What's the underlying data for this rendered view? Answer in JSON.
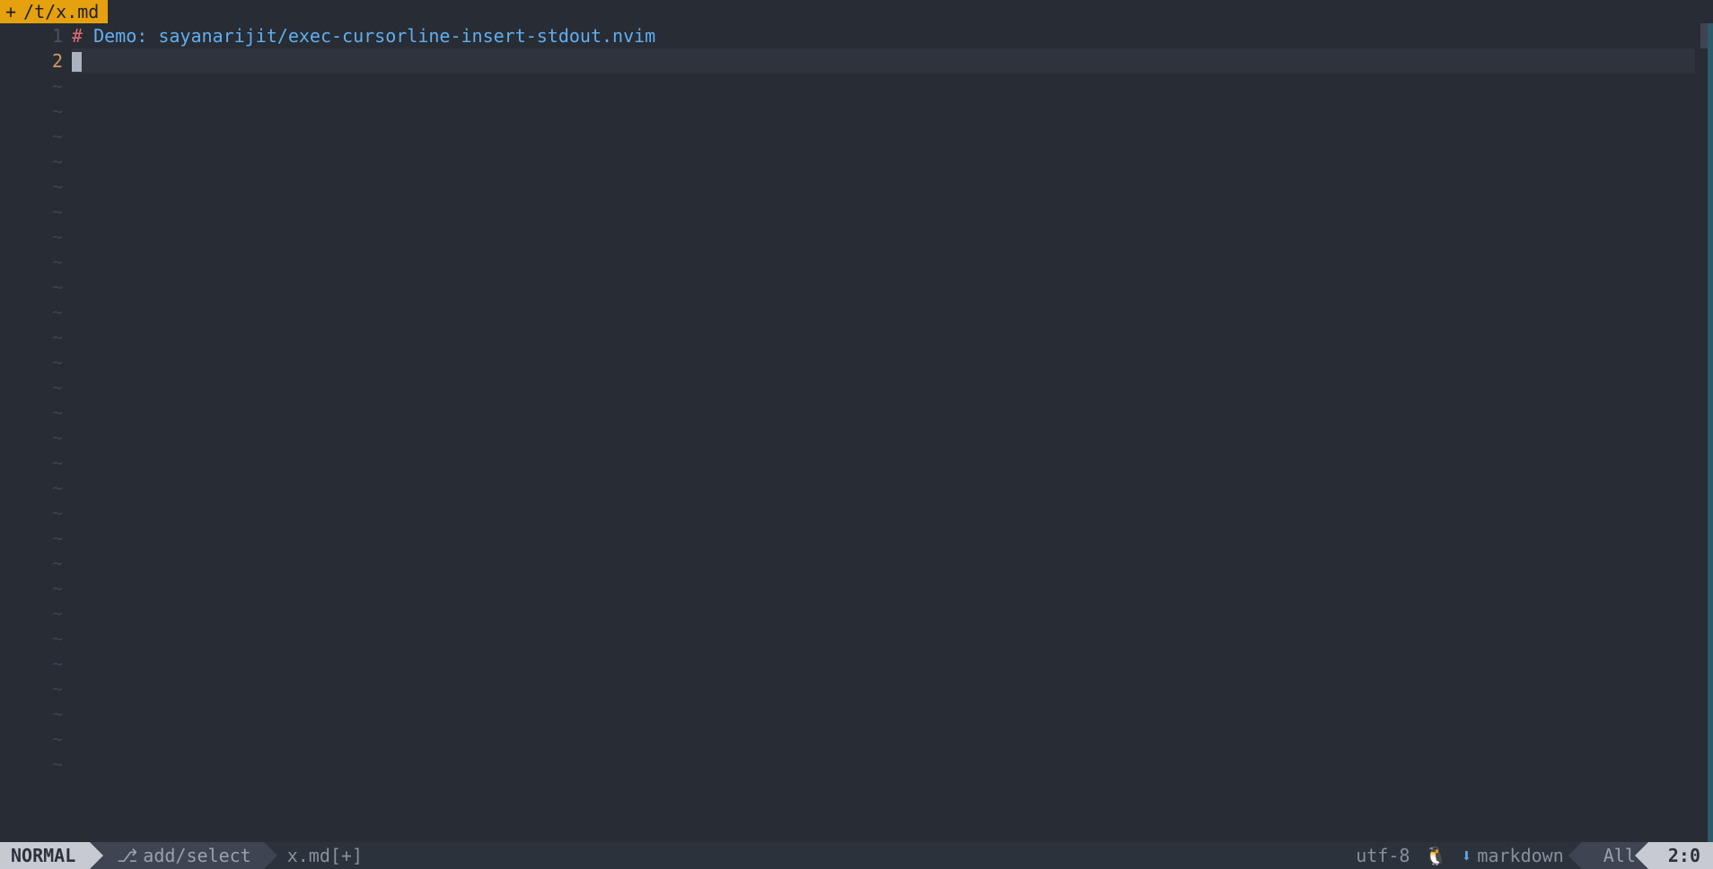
{
  "tab": {
    "modified_indicator": "+",
    "path": "/t/x.md"
  },
  "editor": {
    "lines": [
      {
        "num": "1",
        "hash": "#",
        "text": " Demo: sayanarijit/exec-cursorline-insert-stdout.nvim",
        "current": false
      },
      {
        "num": "2",
        "hash": "",
        "text": "",
        "current": true
      }
    ],
    "tilde": "~",
    "empty_rows": 28
  },
  "status": {
    "mode": "NORMAL",
    "branch_icon": "⎇",
    "branch": "add/select",
    "filename": "x.md[+]",
    "encoding": "utf-8",
    "sep": "",
    "os_icon": "🐧",
    "ft_icon": "⬇",
    "filetype": "markdown",
    "percent": "All",
    "pos": "2:0"
  }
}
